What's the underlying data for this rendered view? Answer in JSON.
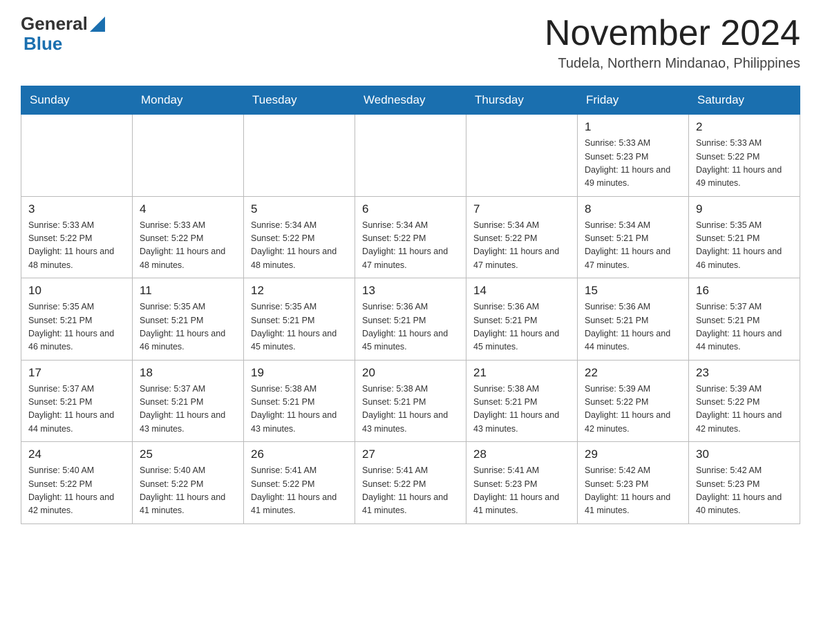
{
  "header": {
    "logo_general": "General",
    "logo_blue": "Blue",
    "month_title": "November 2024",
    "location": "Tudela, Northern Mindanao, Philippines"
  },
  "weekdays": [
    "Sunday",
    "Monday",
    "Tuesday",
    "Wednesday",
    "Thursday",
    "Friday",
    "Saturday"
  ],
  "weeks": [
    [
      {
        "day": "",
        "info": ""
      },
      {
        "day": "",
        "info": ""
      },
      {
        "day": "",
        "info": ""
      },
      {
        "day": "",
        "info": ""
      },
      {
        "day": "",
        "info": ""
      },
      {
        "day": "1",
        "info": "Sunrise: 5:33 AM\nSunset: 5:23 PM\nDaylight: 11 hours and 49 minutes."
      },
      {
        "day": "2",
        "info": "Sunrise: 5:33 AM\nSunset: 5:22 PM\nDaylight: 11 hours and 49 minutes."
      }
    ],
    [
      {
        "day": "3",
        "info": "Sunrise: 5:33 AM\nSunset: 5:22 PM\nDaylight: 11 hours and 48 minutes."
      },
      {
        "day": "4",
        "info": "Sunrise: 5:33 AM\nSunset: 5:22 PM\nDaylight: 11 hours and 48 minutes."
      },
      {
        "day": "5",
        "info": "Sunrise: 5:34 AM\nSunset: 5:22 PM\nDaylight: 11 hours and 48 minutes."
      },
      {
        "day": "6",
        "info": "Sunrise: 5:34 AM\nSunset: 5:22 PM\nDaylight: 11 hours and 47 minutes."
      },
      {
        "day": "7",
        "info": "Sunrise: 5:34 AM\nSunset: 5:22 PM\nDaylight: 11 hours and 47 minutes."
      },
      {
        "day": "8",
        "info": "Sunrise: 5:34 AM\nSunset: 5:21 PM\nDaylight: 11 hours and 47 minutes."
      },
      {
        "day": "9",
        "info": "Sunrise: 5:35 AM\nSunset: 5:21 PM\nDaylight: 11 hours and 46 minutes."
      }
    ],
    [
      {
        "day": "10",
        "info": "Sunrise: 5:35 AM\nSunset: 5:21 PM\nDaylight: 11 hours and 46 minutes."
      },
      {
        "day": "11",
        "info": "Sunrise: 5:35 AM\nSunset: 5:21 PM\nDaylight: 11 hours and 46 minutes."
      },
      {
        "day": "12",
        "info": "Sunrise: 5:35 AM\nSunset: 5:21 PM\nDaylight: 11 hours and 45 minutes."
      },
      {
        "day": "13",
        "info": "Sunrise: 5:36 AM\nSunset: 5:21 PM\nDaylight: 11 hours and 45 minutes."
      },
      {
        "day": "14",
        "info": "Sunrise: 5:36 AM\nSunset: 5:21 PM\nDaylight: 11 hours and 45 minutes."
      },
      {
        "day": "15",
        "info": "Sunrise: 5:36 AM\nSunset: 5:21 PM\nDaylight: 11 hours and 44 minutes."
      },
      {
        "day": "16",
        "info": "Sunrise: 5:37 AM\nSunset: 5:21 PM\nDaylight: 11 hours and 44 minutes."
      }
    ],
    [
      {
        "day": "17",
        "info": "Sunrise: 5:37 AM\nSunset: 5:21 PM\nDaylight: 11 hours and 44 minutes."
      },
      {
        "day": "18",
        "info": "Sunrise: 5:37 AM\nSunset: 5:21 PM\nDaylight: 11 hours and 43 minutes."
      },
      {
        "day": "19",
        "info": "Sunrise: 5:38 AM\nSunset: 5:21 PM\nDaylight: 11 hours and 43 minutes."
      },
      {
        "day": "20",
        "info": "Sunrise: 5:38 AM\nSunset: 5:21 PM\nDaylight: 11 hours and 43 minutes."
      },
      {
        "day": "21",
        "info": "Sunrise: 5:38 AM\nSunset: 5:21 PM\nDaylight: 11 hours and 43 minutes."
      },
      {
        "day": "22",
        "info": "Sunrise: 5:39 AM\nSunset: 5:22 PM\nDaylight: 11 hours and 42 minutes."
      },
      {
        "day": "23",
        "info": "Sunrise: 5:39 AM\nSunset: 5:22 PM\nDaylight: 11 hours and 42 minutes."
      }
    ],
    [
      {
        "day": "24",
        "info": "Sunrise: 5:40 AM\nSunset: 5:22 PM\nDaylight: 11 hours and 42 minutes."
      },
      {
        "day": "25",
        "info": "Sunrise: 5:40 AM\nSunset: 5:22 PM\nDaylight: 11 hours and 41 minutes."
      },
      {
        "day": "26",
        "info": "Sunrise: 5:41 AM\nSunset: 5:22 PM\nDaylight: 11 hours and 41 minutes."
      },
      {
        "day": "27",
        "info": "Sunrise: 5:41 AM\nSunset: 5:22 PM\nDaylight: 11 hours and 41 minutes."
      },
      {
        "day": "28",
        "info": "Sunrise: 5:41 AM\nSunset: 5:23 PM\nDaylight: 11 hours and 41 minutes."
      },
      {
        "day": "29",
        "info": "Sunrise: 5:42 AM\nSunset: 5:23 PM\nDaylight: 11 hours and 41 minutes."
      },
      {
        "day": "30",
        "info": "Sunrise: 5:42 AM\nSunset: 5:23 PM\nDaylight: 11 hours and 40 minutes."
      }
    ]
  ]
}
